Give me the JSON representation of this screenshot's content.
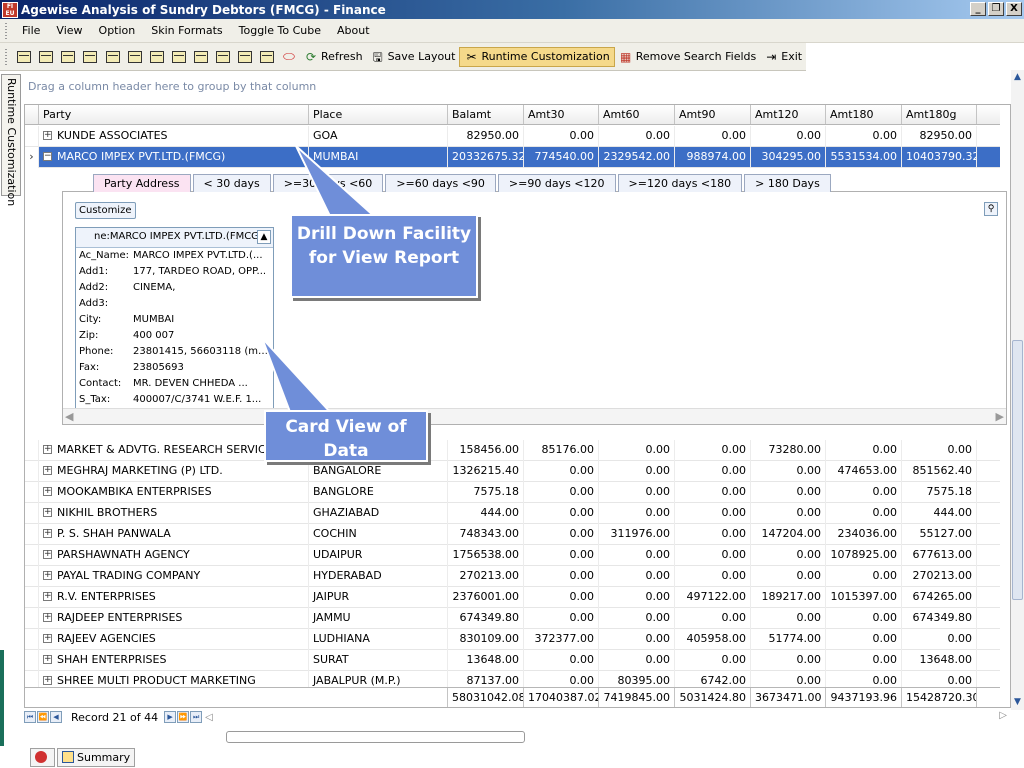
{
  "window": {
    "title": "Agewise Analysis of Sundry Debtors (FMCG) - Finance",
    "icon_text": "FI EU"
  },
  "window_controls": {
    "minimize": "_",
    "restore": "❐",
    "close": "X"
  },
  "menu": [
    "File",
    "View",
    "Option",
    "Skin Formats",
    "Toggle To Cube",
    "About"
  ],
  "toolbar": {
    "refresh": "Refresh",
    "save_layout": "Save Layout",
    "runtime_customization": "Runtime Customization",
    "remove_search_fields": "Remove Search Fields",
    "exit": "Exit"
  },
  "side_tab": "Runtime Customization",
  "group_panel_text": "Drag a column header here to group by that column",
  "columns": [
    "Party",
    "Place",
    "Balamt",
    "Amt30",
    "Amt60",
    "Amt90",
    "Amt120",
    "Amt180",
    "Amt180g"
  ],
  "rows_top": [
    {
      "party": "KUNDE ASSOCIATES",
      "place": "GOA",
      "balamt": "82950.00",
      "amt30": "0.00",
      "amt60": "0.00",
      "amt90": "0.00",
      "amt120": "0.00",
      "amt180": "0.00",
      "amt180g": "82950.00"
    },
    {
      "party": "MARCO IMPEX PVT.LTD.(FMCG)",
      "place": "MUMBAI",
      "balamt": "20332675.32",
      "amt30": "774540.00",
      "amt60": "2329542.00",
      "amt90": "988974.00",
      "amt120": "304295.00",
      "amt180": "5531534.00",
      "amt180g": "10403790.32"
    }
  ],
  "detail_tabs": [
    "Party Address",
    "< 30 days",
    ">=30 days <60",
    ">=60 days <90",
    ">=90 days <120",
    ">=120 days <180",
    "> 180 Days"
  ],
  "detail": {
    "customize": "Customize",
    "card_title": "ne:MARCO IMPEX PVT.LTD.(FMCG",
    "card_fields": [
      {
        "k": "Ac_Name:",
        "v": "MARCO IMPEX PVT.LTD.(..."
      },
      {
        "k": "Add1:",
        "v": "177, TARDEO ROAD, OPP..."
      },
      {
        "k": "Add2:",
        "v": "CINEMA,"
      },
      {
        "k": "Add3:",
        "v": ""
      },
      {
        "k": "City:",
        "v": "MUMBAI"
      },
      {
        "k": "Zip:",
        "v": "400 007"
      },
      {
        "k": "Phone:",
        "v": "23801415, 56603118 (m)..."
      },
      {
        "k": "Fax:",
        "v": "23805693"
      },
      {
        "k": "Contact:",
        "v": "MR. DEVEN CHHEDA ..."
      },
      {
        "k": "S_Tax:",
        "v": "400007/C/3741 W.E.F. 1..."
      }
    ]
  },
  "rows_bottom": [
    {
      "party": "MARKET & ADVTG. RESEARCH SERVICES",
      "place": "",
      "balamt": "158456.00",
      "amt30": "85176.00",
      "amt60": "0.00",
      "amt90": "0.00",
      "amt120": "73280.00",
      "amt180": "0.00",
      "amt180g": "0.00"
    },
    {
      "party": "MEGHRAJ MARKETING (P) LTD.",
      "place": "BANGALORE",
      "balamt": "1326215.40",
      "amt30": "0.00",
      "amt60": "0.00",
      "amt90": "0.00",
      "amt120": "0.00",
      "amt180": "474653.00",
      "amt180g": "851562.40"
    },
    {
      "party": "MOOKAMBIKA ENTERPRISES",
      "place": "BANGLORE",
      "balamt": "7575.18",
      "amt30": "0.00",
      "amt60": "0.00",
      "amt90": "0.00",
      "amt120": "0.00",
      "amt180": "0.00",
      "amt180g": "7575.18"
    },
    {
      "party": "NIKHIL BROTHERS",
      "place": "GHAZIABAD",
      "balamt": "444.00",
      "amt30": "0.00",
      "amt60": "0.00",
      "amt90": "0.00",
      "amt120": "0.00",
      "amt180": "0.00",
      "amt180g": "444.00"
    },
    {
      "party": "P. S. SHAH PANWALA",
      "place": "COCHIN",
      "balamt": "748343.00",
      "amt30": "0.00",
      "amt60": "311976.00",
      "amt90": "0.00",
      "amt120": "147204.00",
      "amt180": "234036.00",
      "amt180g": "55127.00"
    },
    {
      "party": "PARSHAWNATH AGENCY",
      "place": "UDAIPUR",
      "balamt": "1756538.00",
      "amt30": "0.00",
      "amt60": "0.00",
      "amt90": "0.00",
      "amt120": "0.00",
      "amt180": "1078925.00",
      "amt180g": "677613.00"
    },
    {
      "party": "PAYAL TRADING COMPANY",
      "place": "HYDERABAD",
      "balamt": "270213.00",
      "amt30": "0.00",
      "amt60": "0.00",
      "amt90": "0.00",
      "amt120": "0.00",
      "amt180": "0.00",
      "amt180g": "270213.00"
    },
    {
      "party": "R.V. ENTERPRISES",
      "place": "JAIPUR",
      "balamt": "2376001.00",
      "amt30": "0.00",
      "amt60": "0.00",
      "amt90": "497122.00",
      "amt120": "189217.00",
      "amt180": "1015397.00",
      "amt180g": "674265.00"
    },
    {
      "party": "RAJDEEP ENTERPRISES",
      "place": "JAMMU",
      "balamt": "674349.80",
      "amt30": "0.00",
      "amt60": "0.00",
      "amt90": "0.00",
      "amt120": "0.00",
      "amt180": "0.00",
      "amt180g": "674349.80"
    },
    {
      "party": "RAJEEV AGENCIES",
      "place": "LUDHIANA",
      "balamt": "830109.00",
      "amt30": "372377.00",
      "amt60": "0.00",
      "amt90": "405958.00",
      "amt120": "51774.00",
      "amt180": "0.00",
      "amt180g": "0.00"
    },
    {
      "party": "SHAH ENTERPRISES",
      "place": "SURAT",
      "balamt": "13648.00",
      "amt30": "0.00",
      "amt60": "0.00",
      "amt90": "0.00",
      "amt120": "0.00",
      "amt180": "0.00",
      "amt180g": "13648.00"
    },
    {
      "party": "SHREE MULTI PRODUCT MARKETING",
      "place": "JABALPUR (M.P.)",
      "balamt": "87137.00",
      "amt30": "0.00",
      "amt60": "80395.00",
      "amt90": "6742.00",
      "amt120": "0.00",
      "amt180": "0.00",
      "amt180g": "0.00"
    }
  ],
  "totals": {
    "balamt": "58031042.08",
    "amt30": "17040387.02",
    "amt60": "7419845.00",
    "amt90": "5031424.80",
    "amt120": "3673471.00",
    "amt180": "9437193.96",
    "amt180g": "15428720.30"
  },
  "navigator": {
    "record_text": "Record 21 of 44"
  },
  "taskbar": {
    "summary": "Summary"
  },
  "callouts": {
    "drill_down": "Drill Down Facility for View Report",
    "card_view": "Card View of Data"
  }
}
